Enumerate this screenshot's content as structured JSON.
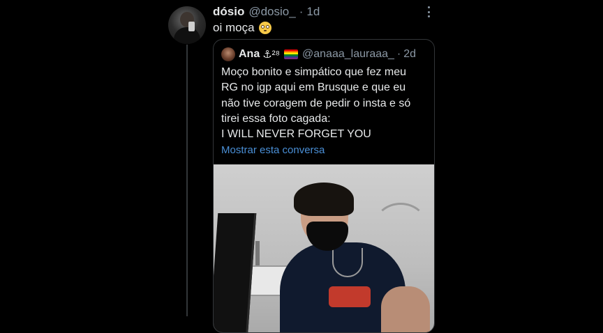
{
  "tweet": {
    "display_name": "dósio",
    "handle": "@dosio_",
    "separator": "·",
    "time": "1d",
    "text": "oi moça",
    "emoji": "flushed-face-emoji"
  },
  "quoted": {
    "display_name": "Ana",
    "name_extra": "⚓²⁸",
    "flag": "rainbow-flag",
    "handle": "@anaaa_lauraaa_",
    "separator": "·",
    "time": "2d",
    "lines": [
      "Moço bonito e simpático que fez meu",
      "RG no igp aqui em Brusque e que eu",
      "não tive coragem de pedir o insta e só",
      "tirei essa foto cagada:",
      "I WILL NEVER FORGET YOU"
    ],
    "show_thread": "Mostrar esta conversa"
  },
  "colors": {
    "background": "#000000",
    "text": "#e7e9ea",
    "secondary": "#8b98a5",
    "link": "#4a8fd6",
    "border": "#333639"
  }
}
